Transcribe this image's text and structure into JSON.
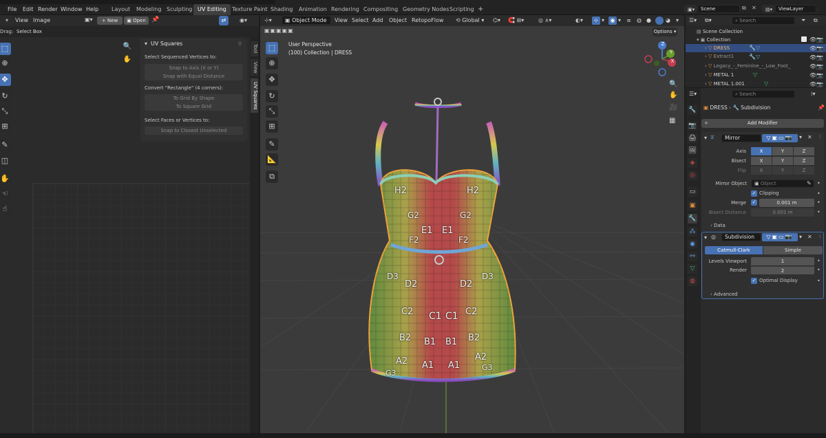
{
  "menus": [
    "File",
    "Edit",
    "Render",
    "Window",
    "Help"
  ],
  "workspaces": [
    "Layout",
    "Modeling",
    "Sculpting",
    "UV Editing",
    "Texture Paint",
    "Shading",
    "Animation",
    "Rendering",
    "Compositing",
    "Geometry Nodes",
    "Scripting"
  ],
  "add_workspace": "+",
  "scene": "Scene",
  "view_layer": "ViewLayer",
  "uv_editor": {
    "drag_label": "Drag:",
    "drag_value": "Select Box",
    "menus": [
      "View",
      "Image"
    ],
    "new_label": "New",
    "open_label": "Open"
  },
  "uv_squares": {
    "title": "UV Squares",
    "heading1": "Select Sequenced Vertices to:",
    "btn_axis": "Snap to Axis (X or Y)",
    "btn_equal": "Snap with Equal Distance",
    "heading2": "Convert \"Rectangle\" (4 corners):",
    "btn_grid": "To Grid By Shape",
    "btn_square": "To Square Grid",
    "heading3": "Select Faces or Vertices to:",
    "btn_closest": "Snap to Closest Unselected"
  },
  "sidetabs": [
    "Tool",
    "View",
    "UV Squares"
  ],
  "viewport": {
    "mode": "Object Mode",
    "menus": [
      "View",
      "Select",
      "Add",
      "Object",
      "RetopoFlow"
    ],
    "transform": "Global",
    "options": "Options",
    "perspective": "User Perspective",
    "collection_info": "(100) Collection | DRESS"
  },
  "gizmo": {
    "x": "X",
    "y": "Y",
    "z": "Z"
  },
  "outliner": {
    "search_placeholder": "Search",
    "items": [
      {
        "label": "Scene Collection"
      },
      {
        "label": "Collection"
      },
      {
        "label": "DRESS"
      },
      {
        "label": "Extract1"
      },
      {
        "label": "Legacy_-_Feminine_-_Low_Foot_"
      },
      {
        "label": "METAL 1"
      },
      {
        "label": "METAL 1.001"
      }
    ]
  },
  "properties": {
    "search_placeholder": "Search",
    "breadcrumb_object": "DRESS",
    "breadcrumb_modifier": "Subdivision",
    "add_modifier": "Add Modifier",
    "mirror": {
      "name": "Mirror",
      "axis_label": "Axis",
      "bisect_label": "Bisect",
      "flip_label": "Flip",
      "x": "X",
      "y": "Y",
      "z": "Z",
      "mirror_object_label": "Mirror Object",
      "object_placeholder": "Object",
      "clipping_label": "Clipping",
      "merge_label": "Merge",
      "merge_value": "0.001 m",
      "bisect_distance_label": "Bisect Distance",
      "bisect_distance_value": "0.001 m",
      "data_label": "Data"
    },
    "subdivision": {
      "name": "Subdivision",
      "catmull": "Catmull-Clark",
      "simple": "Simple",
      "levels_viewport_label": "Levels Viewport",
      "levels_viewport_value": "1",
      "render_label": "Render",
      "render_value": "2",
      "optimal_display_label": "Optimal Display",
      "advanced_label": "Advanced"
    }
  },
  "uv_labels": [
    "H2",
    "H2",
    "G2",
    "G2",
    "F2",
    "F2",
    "E1",
    "E1",
    "D2",
    "D2",
    "D3",
    "D3",
    "C2",
    "C2",
    "C1",
    "C1",
    "B2",
    "B2",
    "B1",
    "B1",
    "A2",
    "A2",
    "A1",
    "A1",
    "G3",
    "G3"
  ]
}
